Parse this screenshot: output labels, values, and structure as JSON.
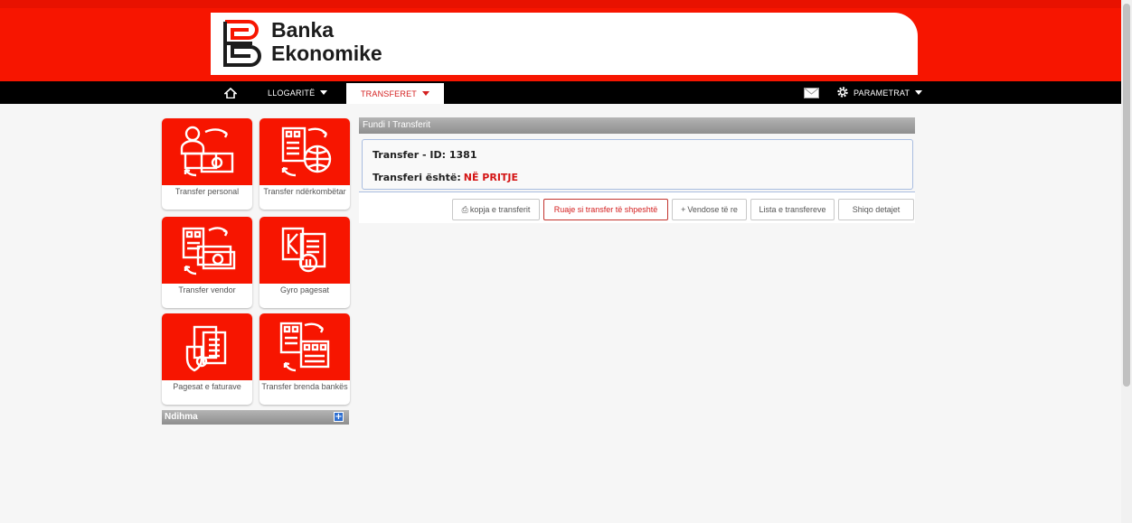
{
  "brand": {
    "line1": "Banka",
    "line2": "Ekonomike",
    "red": "#f71500"
  },
  "nav": {
    "home_icon": "home-icon",
    "items": [
      {
        "label": "LLOGARITË",
        "active": false
      },
      {
        "label": "TRANSFERET",
        "active": true
      }
    ],
    "mail_icon": "mail-icon",
    "settings_icon": "gear-icon",
    "settings_label": "PARAMETRAT"
  },
  "tiles": [
    {
      "label": "Transfer personal",
      "icon": "person-money-icon"
    },
    {
      "label": "Transfer ndërkombëtar",
      "icon": "bank-globe-icon"
    },
    {
      "label": "Transfer vendor",
      "icon": "bank-money-icon"
    },
    {
      "label": "Gyro pagesat",
      "icon": "giro-document-icon"
    },
    {
      "label": "Pagesat e faturave",
      "icon": "invoice-shield-icon"
    },
    {
      "label": "Transfer brenda bankës",
      "icon": "bank-to-bank-icon"
    }
  ],
  "help": {
    "title": "Ndihma"
  },
  "panel": {
    "header": "Fundi I Transferit",
    "transfer_label": "Transfer - ID: 1381",
    "status_label": "Transferi është:",
    "status_value": "NË PRITJE"
  },
  "buttons": [
    {
      "label": "kopja e transferit",
      "icon": "print-icon"
    },
    {
      "label": "Ruaje si transfer të shpeshtë"
    },
    {
      "label": "Vendose të re",
      "icon": "plus-icon"
    },
    {
      "label": "Lista e transfereve"
    },
    {
      "label": "Shiqo detajet"
    }
  ]
}
